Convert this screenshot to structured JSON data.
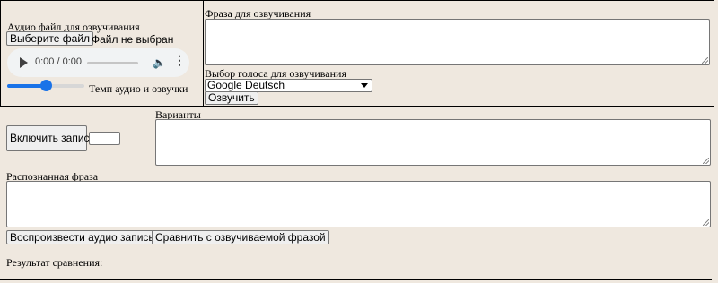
{
  "top_panel": {
    "audio_file_label": "Аудио файл для озвучивания",
    "choose_file_button": "Выберите файл",
    "no_file_text": "Файл не выбран",
    "audio_player": {
      "time": "0:00 / 0:00"
    },
    "tempo": {
      "label": "Темп аудио и озвучки",
      "value_fraction": 0.5
    },
    "phrase_label": "Фраза для озвучивания",
    "phrase_value": "",
    "voice_label": "Выбор голоса для озвучивания",
    "voice_selected": "Google Deutsch",
    "speak_button": "Озвучить"
  },
  "recording": {
    "record_button": "Включить запись",
    "record_counter_value": "",
    "variants_label": "Варианты",
    "variants_value": ""
  },
  "recognized": {
    "label": "Распознанная фраза",
    "value": ""
  },
  "actions": {
    "play_recording_button": "Воспроизвести аудио запись",
    "compare_button": "Сравнить с озвучиваемой фразой"
  },
  "result": {
    "label": "Результат сравнения:"
  }
}
